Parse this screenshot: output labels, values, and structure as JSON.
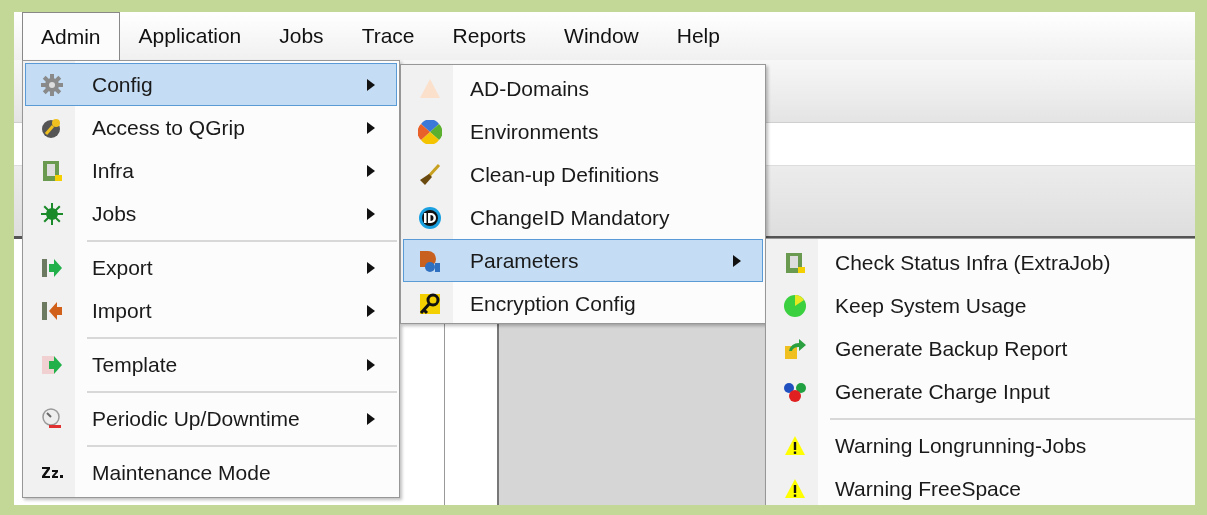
{
  "menubar": [
    {
      "label": "Admin",
      "selected": true
    },
    {
      "label": "Application",
      "selected": false
    },
    {
      "label": "Jobs",
      "selected": false
    },
    {
      "label": "Trace",
      "selected": false
    },
    {
      "label": "Reports",
      "selected": false
    },
    {
      "label": "Window",
      "selected": false
    },
    {
      "label": "Help",
      "selected": false
    }
  ],
  "menus": [
    {
      "items": [
        {
          "kind": "item",
          "label": "Config",
          "submenu": true,
          "selected": true
        },
        {
          "kind": "item",
          "label": "Access to QGrip",
          "submenu": true,
          "selected": false
        },
        {
          "kind": "item",
          "label": "Infra",
          "submenu": true,
          "selected": false
        },
        {
          "kind": "item",
          "label": "Jobs",
          "submenu": true,
          "selected": false
        },
        {
          "kind": "separator"
        },
        {
          "kind": "item",
          "label": "Export",
          "submenu": true,
          "selected": false
        },
        {
          "kind": "item",
          "label": "Import",
          "submenu": true,
          "selected": false
        },
        {
          "kind": "separator"
        },
        {
          "kind": "item",
          "label": "Template",
          "submenu": true,
          "selected": false
        },
        {
          "kind": "separator"
        },
        {
          "kind": "item",
          "label": "Periodic Up/Downtime",
          "submenu": true,
          "selected": false
        },
        {
          "kind": "separator"
        },
        {
          "kind": "item",
          "label": "Maintenance Mode",
          "submenu": false,
          "selected": false
        }
      ]
    },
    {
      "items": [
        {
          "kind": "item",
          "label": "AD-Domains",
          "submenu": false,
          "selected": false
        },
        {
          "kind": "item",
          "label": "Environments",
          "submenu": false,
          "selected": false
        },
        {
          "kind": "item",
          "label": "Clean-up Definitions",
          "submenu": false,
          "selected": false
        },
        {
          "kind": "item",
          "label": "ChangeID Mandatory",
          "submenu": false,
          "selected": false
        },
        {
          "kind": "item",
          "label": "Parameters",
          "submenu": true,
          "selected": true
        },
        {
          "kind": "item",
          "label": "Encryption Config",
          "submenu": false,
          "selected": false
        }
      ]
    },
    {
      "items": [
        {
          "kind": "item",
          "label": "Check Status Infra (ExtraJob)",
          "submenu": false,
          "selected": false
        },
        {
          "kind": "item",
          "label": "Keep System Usage",
          "submenu": false,
          "selected": false
        },
        {
          "kind": "item",
          "label": "Generate Backup Report",
          "submenu": false,
          "selected": false
        },
        {
          "kind": "item",
          "label": "Generate Charge Input",
          "submenu": false,
          "selected": false
        },
        {
          "kind": "separator"
        },
        {
          "kind": "item",
          "label": "Warning Longrunning-Jobs",
          "submenu": false,
          "selected": false
        },
        {
          "kind": "item",
          "label": "Warning FreeSpace",
          "submenu": false,
          "selected": false
        }
      ]
    }
  ]
}
